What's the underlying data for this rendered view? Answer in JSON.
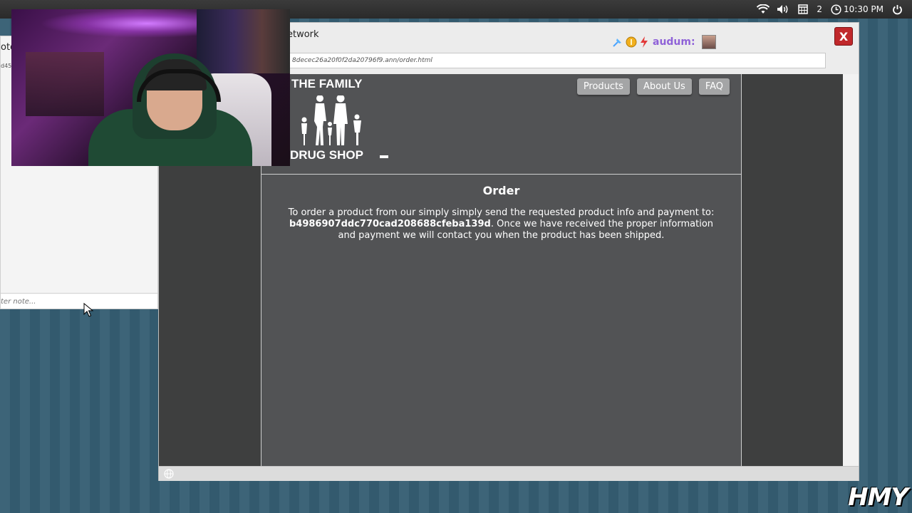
{
  "tray": {
    "workspace": "2",
    "clock": "10:30 PM"
  },
  "notes": {
    "title": "ote",
    "id_fragment": "d45",
    "input_placeholder": "ter note..."
  },
  "browser": {
    "title": "etwork",
    "close_label": "X",
    "user": {
      "name": "audum:"
    },
    "url": "8decec26a20f0f2da20796f9.ann/order.html"
  },
  "site": {
    "logo_top": "THE FAMILY",
    "logo_bottom": "DRUG SHOP",
    "nav": {
      "products": "Products",
      "about": "About Us",
      "faq": "FAQ"
    },
    "heading": "Order",
    "text_before": "To order a product from our simply simply send the requested product info and payment to:",
    "address": "b4986907ddc770cad208688cfeba139d",
    "text_after": ". Once we have received the proper information and payment we will contact you when the product has been shipped."
  },
  "watermark": "HMY"
}
